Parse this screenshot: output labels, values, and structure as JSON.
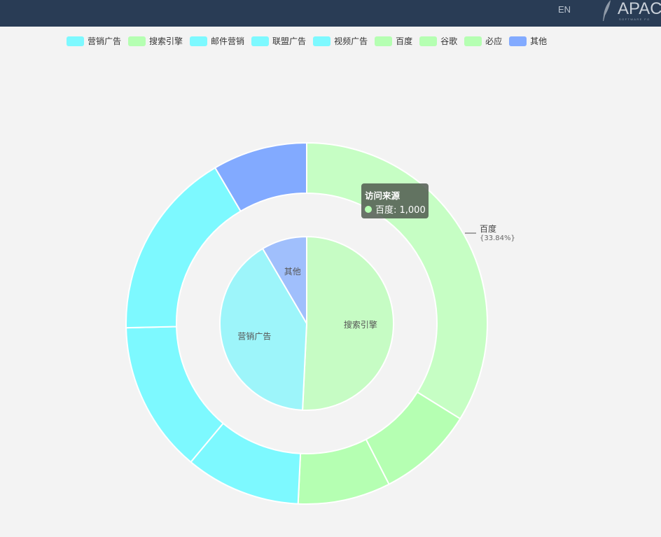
{
  "header": {
    "lang_label": "EN",
    "logo_text": "APAC",
    "logo_subtext": "SOFTWARE FO"
  },
  "legend": [
    {
      "label": "营销广告",
      "color": "#7df9ff"
    },
    {
      "label": "搜索引擎",
      "color": "#b5ffb2"
    },
    {
      "label": "邮件营销",
      "color": "#7df9ff"
    },
    {
      "label": "联盟广告",
      "color": "#7df9ff"
    },
    {
      "label": "视频广告",
      "color": "#7df9ff"
    },
    {
      "label": "百度",
      "color": "#b5ffb2"
    },
    {
      "label": "谷歌",
      "color": "#b5ffb2"
    },
    {
      "label": "必应",
      "color": "#b5ffb2"
    },
    {
      "label": "其他",
      "color": "#82aaff"
    }
  ],
  "tooltip": {
    "title": "访问来源",
    "item_label": "百度: 1,000",
    "dot_color": "#b5ffb2"
  },
  "chart_data": {
    "type": "pie",
    "title": "",
    "series_name": "访问来源",
    "legend_position": "top",
    "inner": [
      {
        "name": "搜索引擎",
        "value": 1500,
        "color": "#c6fcc4"
      },
      {
        "name": "营销广告",
        "value": 1205,
        "color": "#9df5fa"
      },
      {
        "name": "其他",
        "value": 250,
        "color": "#a0bffc"
      }
    ],
    "outer": [
      {
        "name": "百度",
        "value": 1000,
        "color": "#c6fec4",
        "label": "百度",
        "percent_label": "{33.84%}"
      },
      {
        "name": "谷歌",
        "value": 255,
        "color": "#b5ffb2"
      },
      {
        "name": "必应",
        "value": 245,
        "color": "#b5ffb2"
      },
      {
        "name": "视频广告",
        "value": 305,
        "color": "#7df9ff"
      },
      {
        "name": "联盟广告",
        "value": 400,
        "color": "#7df9ff"
      },
      {
        "name": "邮件营销",
        "value": 500,
        "color": "#7df9ff"
      },
      {
        "name": "其他",
        "value": 250,
        "color": "#82aaff"
      }
    ]
  }
}
